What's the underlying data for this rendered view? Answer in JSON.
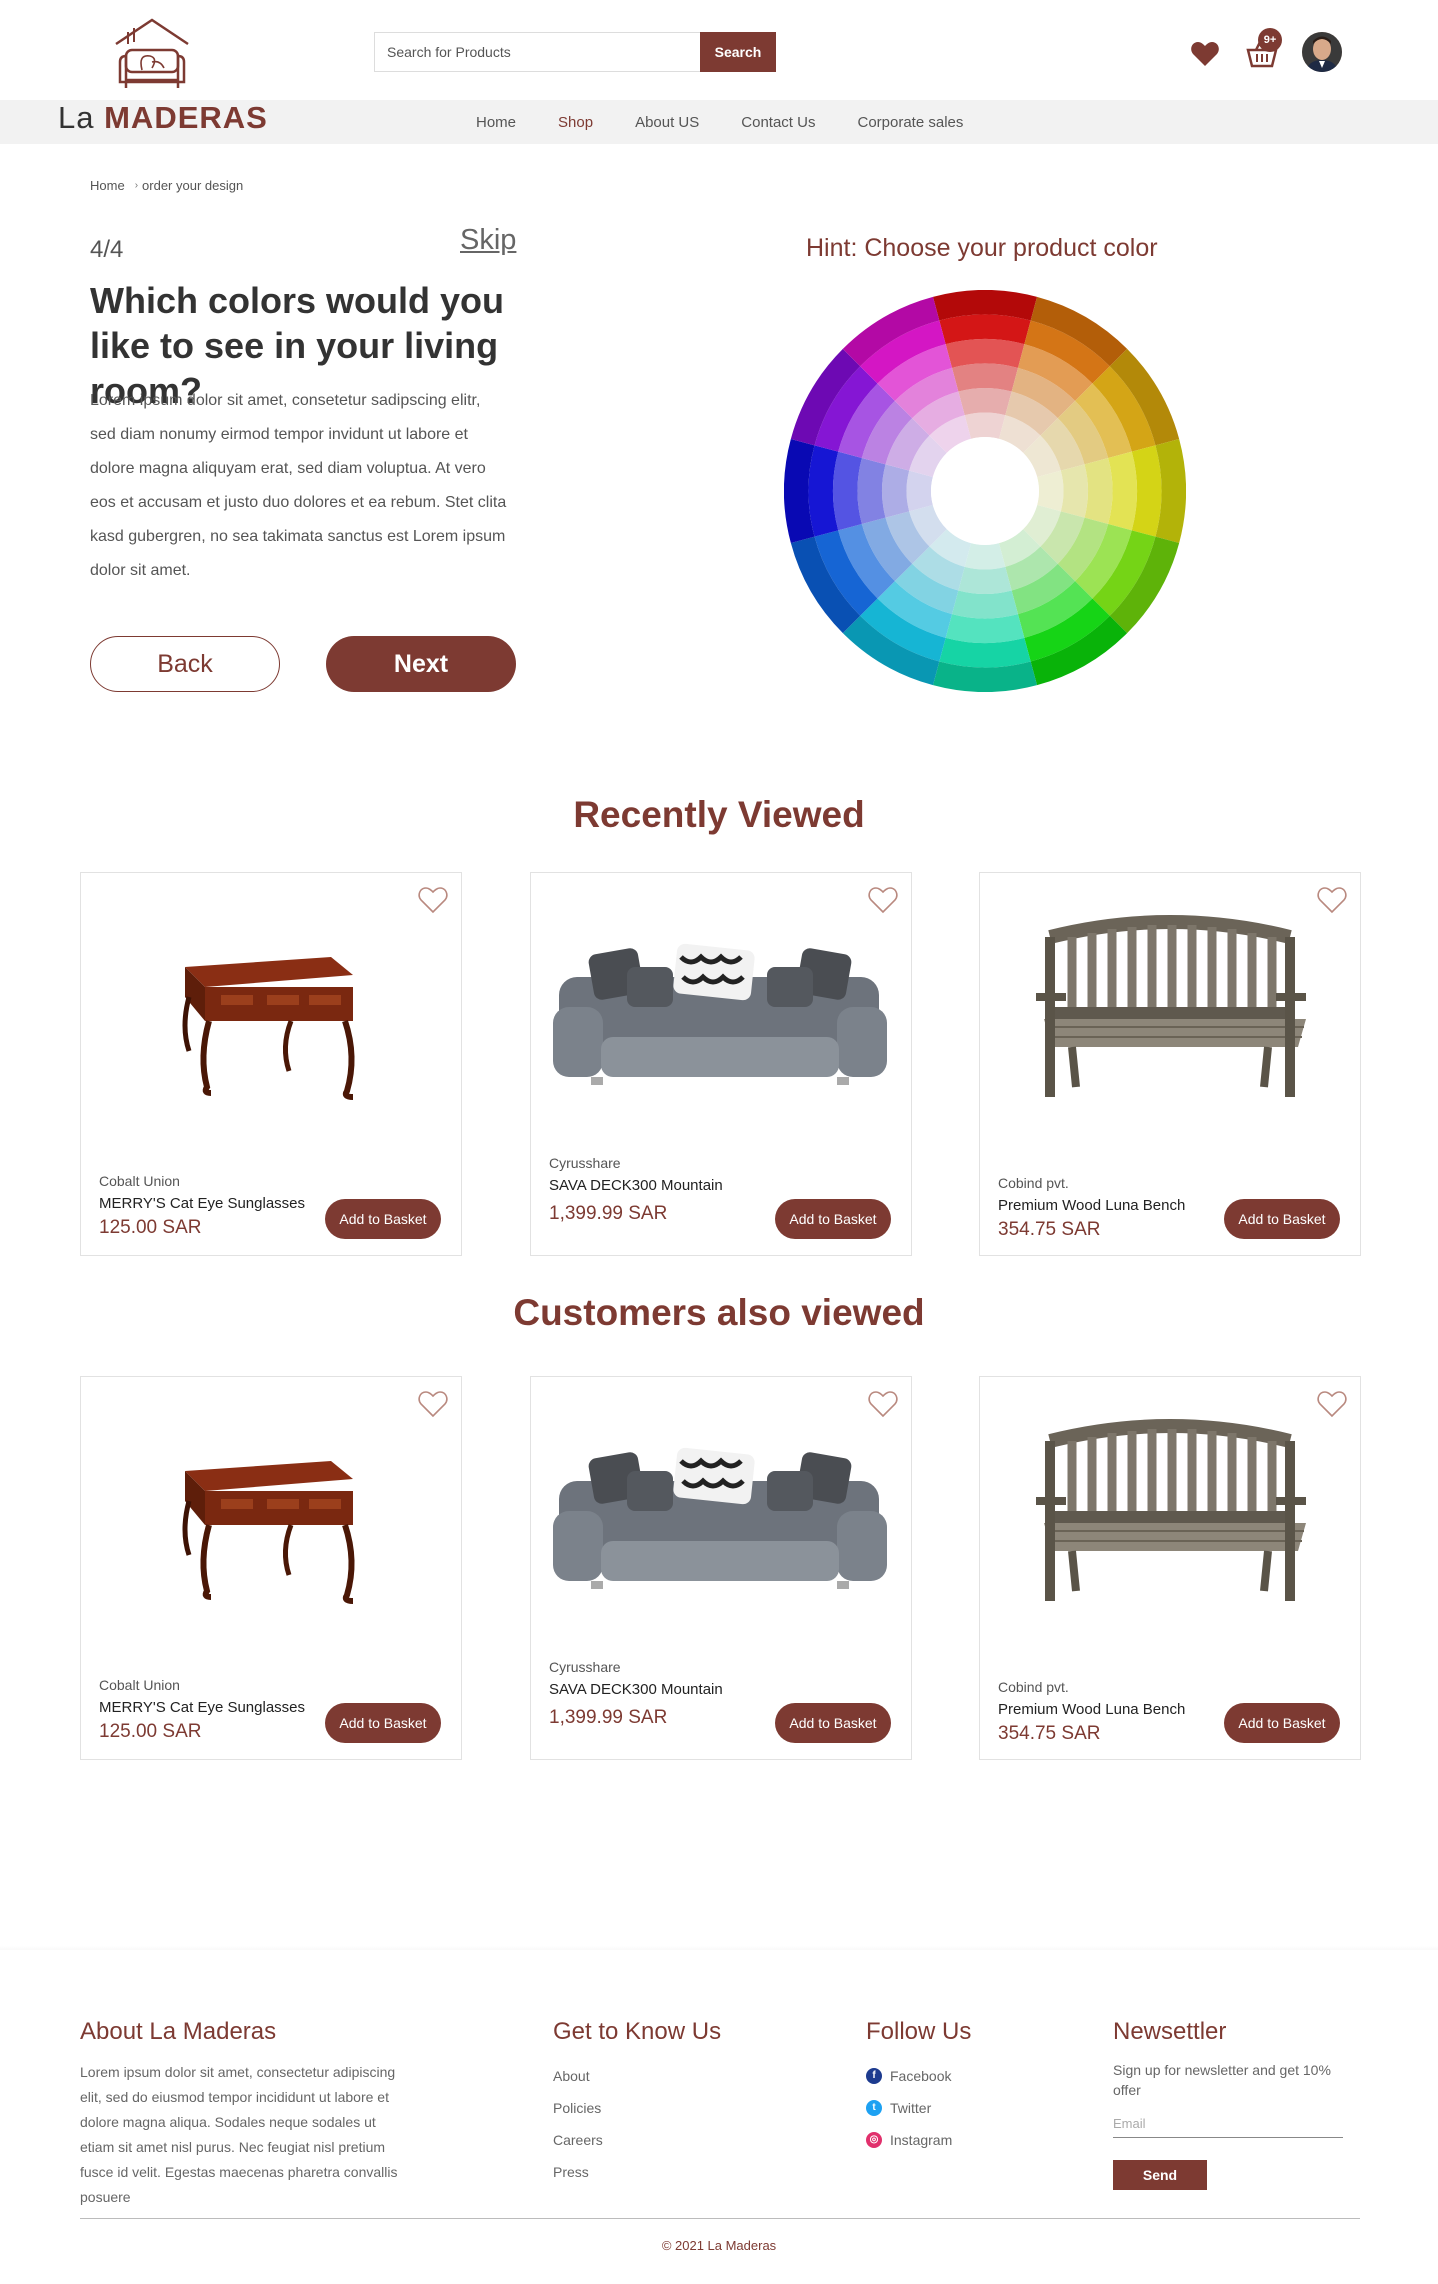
{
  "header": {
    "logo_la": "La",
    "logo_maderas": "MADERAS",
    "search_placeholder": "Search for Products",
    "search_label": "Search",
    "cart_badge": "9+",
    "nav": [
      {
        "label": "Home",
        "active": false
      },
      {
        "label": "Shop",
        "active": true
      },
      {
        "label": "About US",
        "active": false
      },
      {
        "label": "Contact Us",
        "active": false
      },
      {
        "label": "Corporate sales",
        "active": false
      }
    ]
  },
  "breadcrumb": {
    "home": "Home",
    "current": "order your design"
  },
  "wizard": {
    "step": "4/4",
    "skip": "Skip",
    "question": "Which colors would you like to see in your living room?",
    "description": "Lorem ipsum dolor sit amet, consetetur sadipscing elitr, sed diam nonumy eirmod tempor invidunt ut labore et dolore magna aliquyam erat, sed diam voluptua. At vero eos et accusam et justo duo dolores et ea rebum. Stet clita kasd gubergren, no sea takimata sanctus est Lorem ipsum dolor sit amet.",
    "back_label": "Back",
    "next_label": "Next",
    "hint": "Hint: Choose your product color"
  },
  "recently_viewed": {
    "title": "Recently Viewed",
    "products": [
      {
        "brand": "Cobalt Union",
        "name": "MERRY'S Cat Eye Sunglasses",
        "price": "125.00 SAR",
        "button": "Add to Basket",
        "image": "wooden-desk"
      },
      {
        "brand": "Cyrusshare",
        "name": "SAVA DECK300 Mountain",
        "price": "1,399.99 SAR",
        "button": "Add to Basket",
        "image": "grey-sofa"
      },
      {
        "brand": "Cobind pvt.",
        "name": "Premium Wood Luna Bench",
        "price": "354.75 SAR",
        "button": "Add to Basket",
        "image": "wood-bench"
      }
    ]
  },
  "customers_viewed": {
    "title": "Customers also viewed",
    "products": [
      {
        "brand": "Cobalt Union",
        "name": "MERRY'S Cat Eye Sunglasses",
        "price": "125.00 SAR",
        "button": "Add to Basket",
        "image": "wooden-desk"
      },
      {
        "brand": "Cyrusshare",
        "name": "SAVA DECK300 Mountain",
        "price": "1,399.99 SAR",
        "button": "Add to Basket",
        "image": "grey-sofa"
      },
      {
        "brand": "Cobind pvt.",
        "name": "Premium Wood Luna Bench",
        "price": "354.75 SAR",
        "button": "Add to Basket",
        "image": "wood-bench"
      }
    ]
  },
  "footer": {
    "about_title": "About La Maderas",
    "about_text": "Lorem ipsum dolor sit amet, consectetur adipiscing elit, sed do eiusmod tempor incididunt ut labore et dolore magna aliqua. Sodales neque sodales ut etiam sit amet nisl purus. Nec feugiat nisl pretium fusce id velit. Egestas maecenas pharetra convallis posuere",
    "know_title": "Get to Know Us",
    "know_links": [
      "About",
      "Policies",
      "Careers",
      "Press"
    ],
    "follow_title": "Follow Us",
    "social": [
      "Facebook",
      "Twitter",
      "Instagram"
    ],
    "newsletter_title": "Newsettler",
    "newsletter_text": "Sign up for newsletter and get 10% offer",
    "email_placeholder": "Email",
    "send_label": "Send",
    "copyright": "© 2021 La Maderas"
  },
  "colors": {
    "brand": "#7d3a32",
    "nav_bg": "#f2f2f2"
  }
}
